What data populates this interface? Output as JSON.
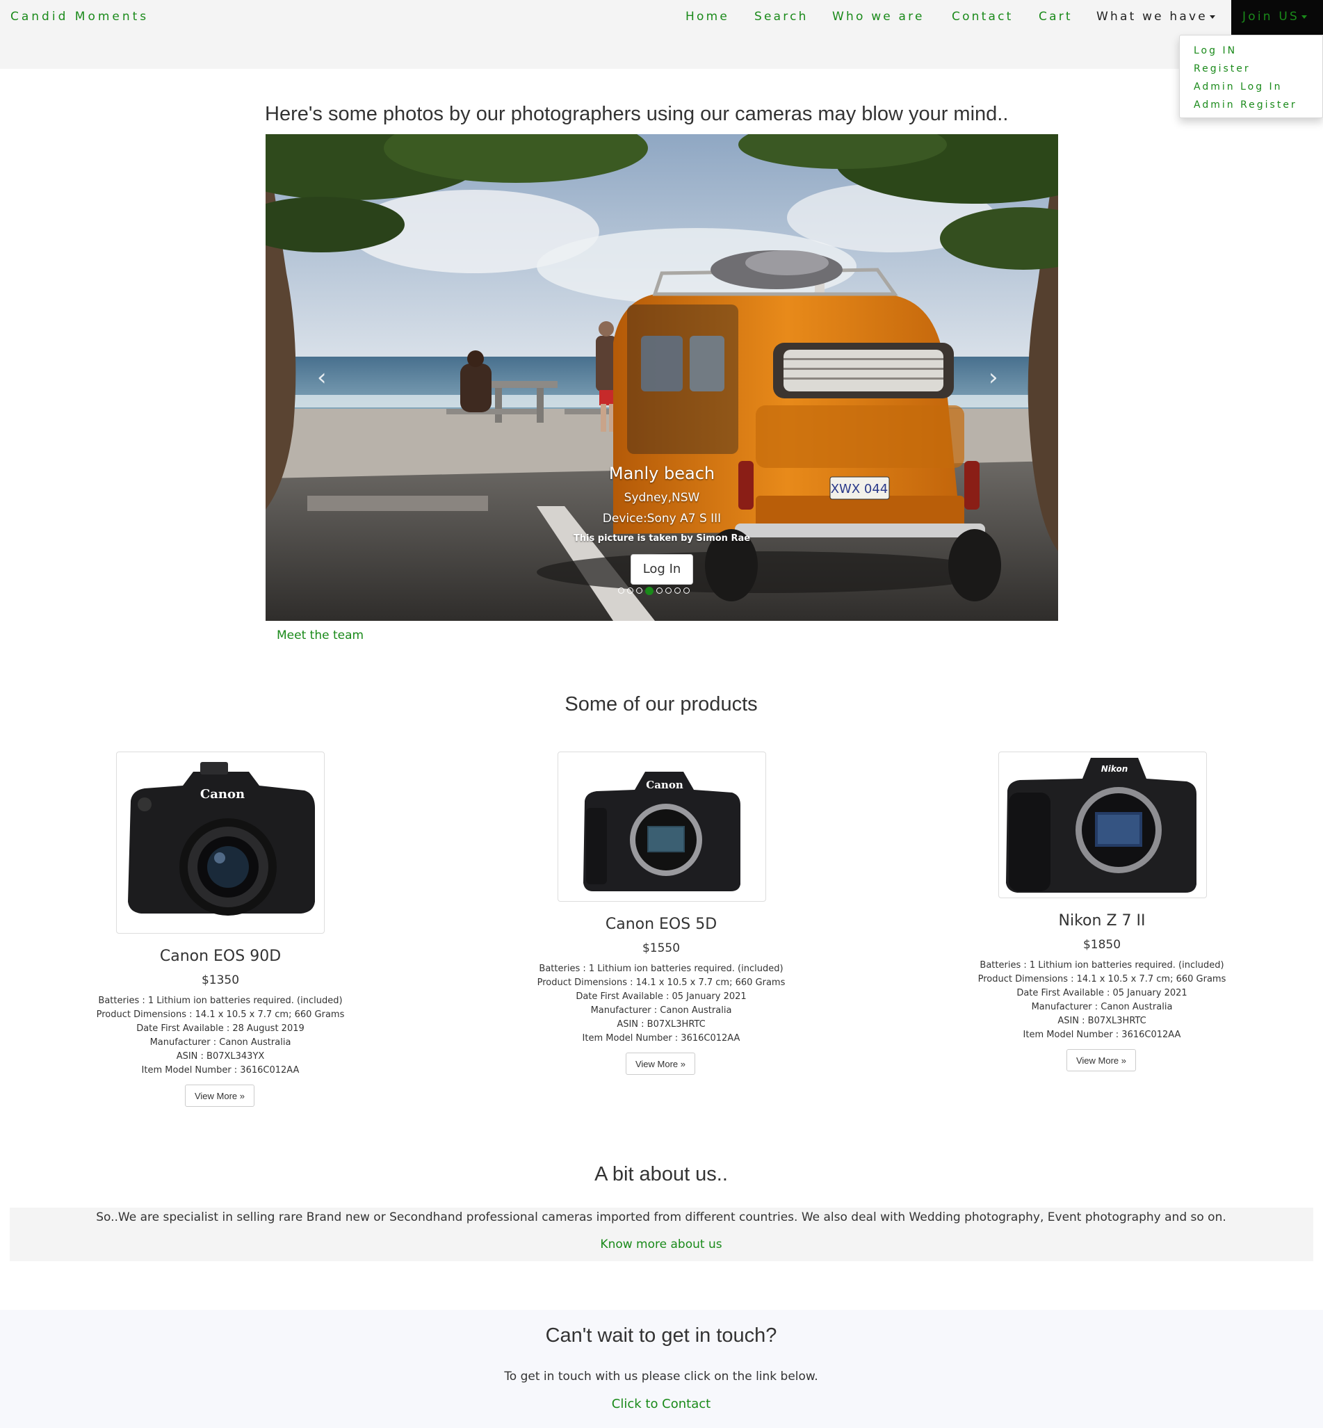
{
  "navbar": {
    "brand": "Candid Moments",
    "links": [
      "Home",
      "Search",
      "Who we are",
      "Contact",
      "Cart"
    ],
    "what_we_have": "What we have",
    "join": "Join US",
    "dropdown": [
      "Log IN",
      "Register",
      "Admin Log In",
      "Admin Register"
    ]
  },
  "carousel": {
    "heading": "Here's some photos by our photographers using our cameras may blow your mind..",
    "caption_title": "Manly beach",
    "caption_location": "Sydney,NSW",
    "caption_device": "Device:Sony A7 S III",
    "caption_credit": "This picture is taken by Simon Rae",
    "login_label": "Log In",
    "slide_count": 8,
    "active_slide": 4,
    "plate": "XWX 044",
    "meet_team": "Meet the team"
  },
  "products": {
    "heading": "Some of our products",
    "view_more": "View More »",
    "items": [
      {
        "name": "Canon EOS 90D",
        "price": "$1350",
        "brand_label": "Canon",
        "specs": [
          "Batteries : 1 Lithium ion batteries required. (included)",
          "Product Dimensions : 14.1 x 10.5 x 7.7 cm; 660 Grams",
          "Date First Available : 28 August 2019",
          "Manufacturer : Canon Australia",
          "ASIN : B07XL343YX",
          "Item Model Number : 3616C012AA"
        ]
      },
      {
        "name": "Canon EOS 5D",
        "price": "$1550",
        "brand_label": "Canon",
        "specs": [
          "Batteries : 1 Lithium ion batteries required. (included)",
          "Product Dimensions : 14.1 x 10.5 x 7.7 cm; 660 Grams",
          "Date First Available : 05 January 2021",
          "Manufacturer : Canon Australia",
          "ASIN : B07XL3HRTC",
          "Item Model Number : 3616C012AA"
        ]
      },
      {
        "name": "Nikon Z 7 II",
        "price": "$1850",
        "brand_label": "Nikon",
        "specs": [
          "Batteries : 1 Lithium ion batteries required. (included)",
          "Product Dimensions : 14.1 x 10.5 x 7.7 cm; 660 Grams",
          "Date First Available : 05 January 2021",
          "Manufacturer : Canon Australia",
          "ASIN : B07XL3HRTC",
          "Item Model Number : 3616C012AA"
        ]
      }
    ]
  },
  "about": {
    "heading": "A bit about us..",
    "text": "So..We are specialist in selling rare Brand new or Secondhand professional cameras imported from different countries. We also deal with Wedding photography, Event photography and so on.",
    "link": "Know more about us"
  },
  "contact": {
    "heading": "Can't wait to get in touch?",
    "text": "To get in touch with us please click on the link below.",
    "link": "Click to Contact"
  },
  "colors": {
    "accent": "#1a8a1a",
    "navbar_bg": "#f4f4f4",
    "join_bg": "#080808",
    "van": "#d9780f"
  }
}
